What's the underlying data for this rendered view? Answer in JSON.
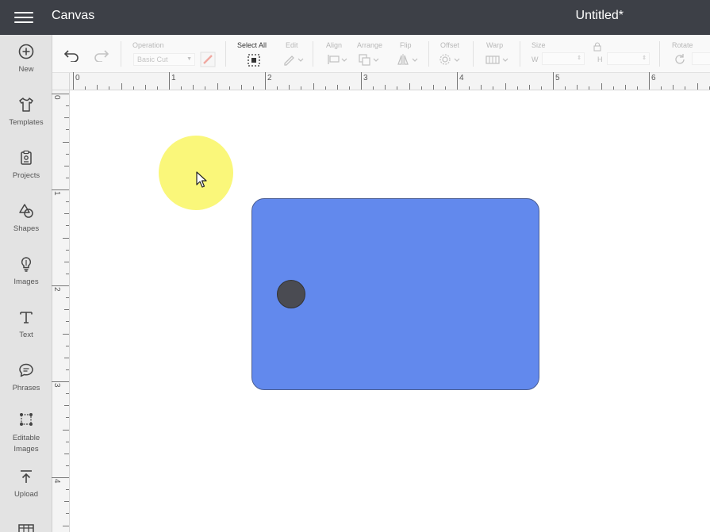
{
  "header": {
    "app_title": "Canvas",
    "doc_title": "Untitled*",
    "menu_icon": "hamburger-menu-icon"
  },
  "sidebar": {
    "items": [
      {
        "label": "New",
        "icon": "plus-circle-icon"
      },
      {
        "label": "Templates",
        "icon": "tshirt-icon"
      },
      {
        "label": "Projects",
        "icon": "clipboard-icon"
      },
      {
        "label": "Shapes",
        "icon": "shapes-icon"
      },
      {
        "label": "Images",
        "icon": "lightbulb-icon"
      },
      {
        "label": "Text",
        "icon": "text-t-icon"
      },
      {
        "label": "Phrases",
        "icon": "speech-bubble-icon"
      },
      {
        "label": "Editable",
        "label2": "Images",
        "icon": "editable-images-icon"
      },
      {
        "label": "Upload",
        "icon": "upload-icon"
      }
    ]
  },
  "toolbar": {
    "operation_label": "Operation",
    "operation_value": "Basic Cut",
    "select_all_label": "Select All",
    "edit_label": "Edit",
    "align_label": "Align",
    "arrange_label": "Arrange",
    "flip_label": "Flip",
    "offset_label": "Offset",
    "warp_label": "Warp",
    "size_label": "Size",
    "size_w": "W",
    "size_h": "H",
    "rotate_label": "Rotate"
  },
  "rulers": {
    "top_numbers": [
      "0",
      "1",
      "2",
      "3",
      "4",
      "5",
      "6"
    ],
    "left_numbers": [
      "0",
      "1",
      "2",
      "3",
      "4"
    ]
  },
  "colors": {
    "topbar": "#3d4047",
    "shape_fill": "#6289ed",
    "hole_fill": "#4a4b52",
    "highlight": "#faf77a"
  }
}
